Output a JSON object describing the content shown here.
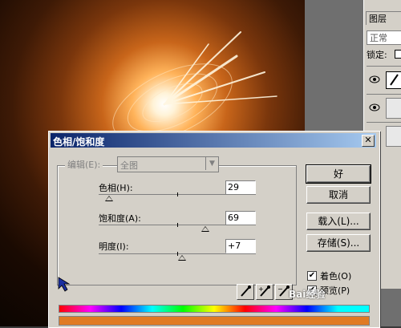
{
  "dialog": {
    "title": "色相/饱和度",
    "edit_label": "编辑(E):",
    "edit_value": "全图",
    "hue": {
      "label": "色相(H):",
      "value": "29"
    },
    "saturation": {
      "label": "饱和度(A):",
      "value": "69"
    },
    "lightness": {
      "label": "明度(I):",
      "value": "+7"
    },
    "buttons": {
      "ok": "好",
      "cancel": "取消",
      "load": "载入(L)...",
      "save": "存储(S)..."
    },
    "colorize": {
      "label": "着色(O)",
      "checked": true
    },
    "preview": {
      "label": "预览(P)",
      "checked": true
    }
  },
  "layers_panel": {
    "tab": "图层",
    "blend_mode": "正常",
    "lock_label": "锁定:"
  },
  "watermark": "Bai经验",
  "colors": {
    "titlebar_start": "#0a246a",
    "titlebar_end": "#a6caf0",
    "colorize_bar": "#e07a24"
  }
}
